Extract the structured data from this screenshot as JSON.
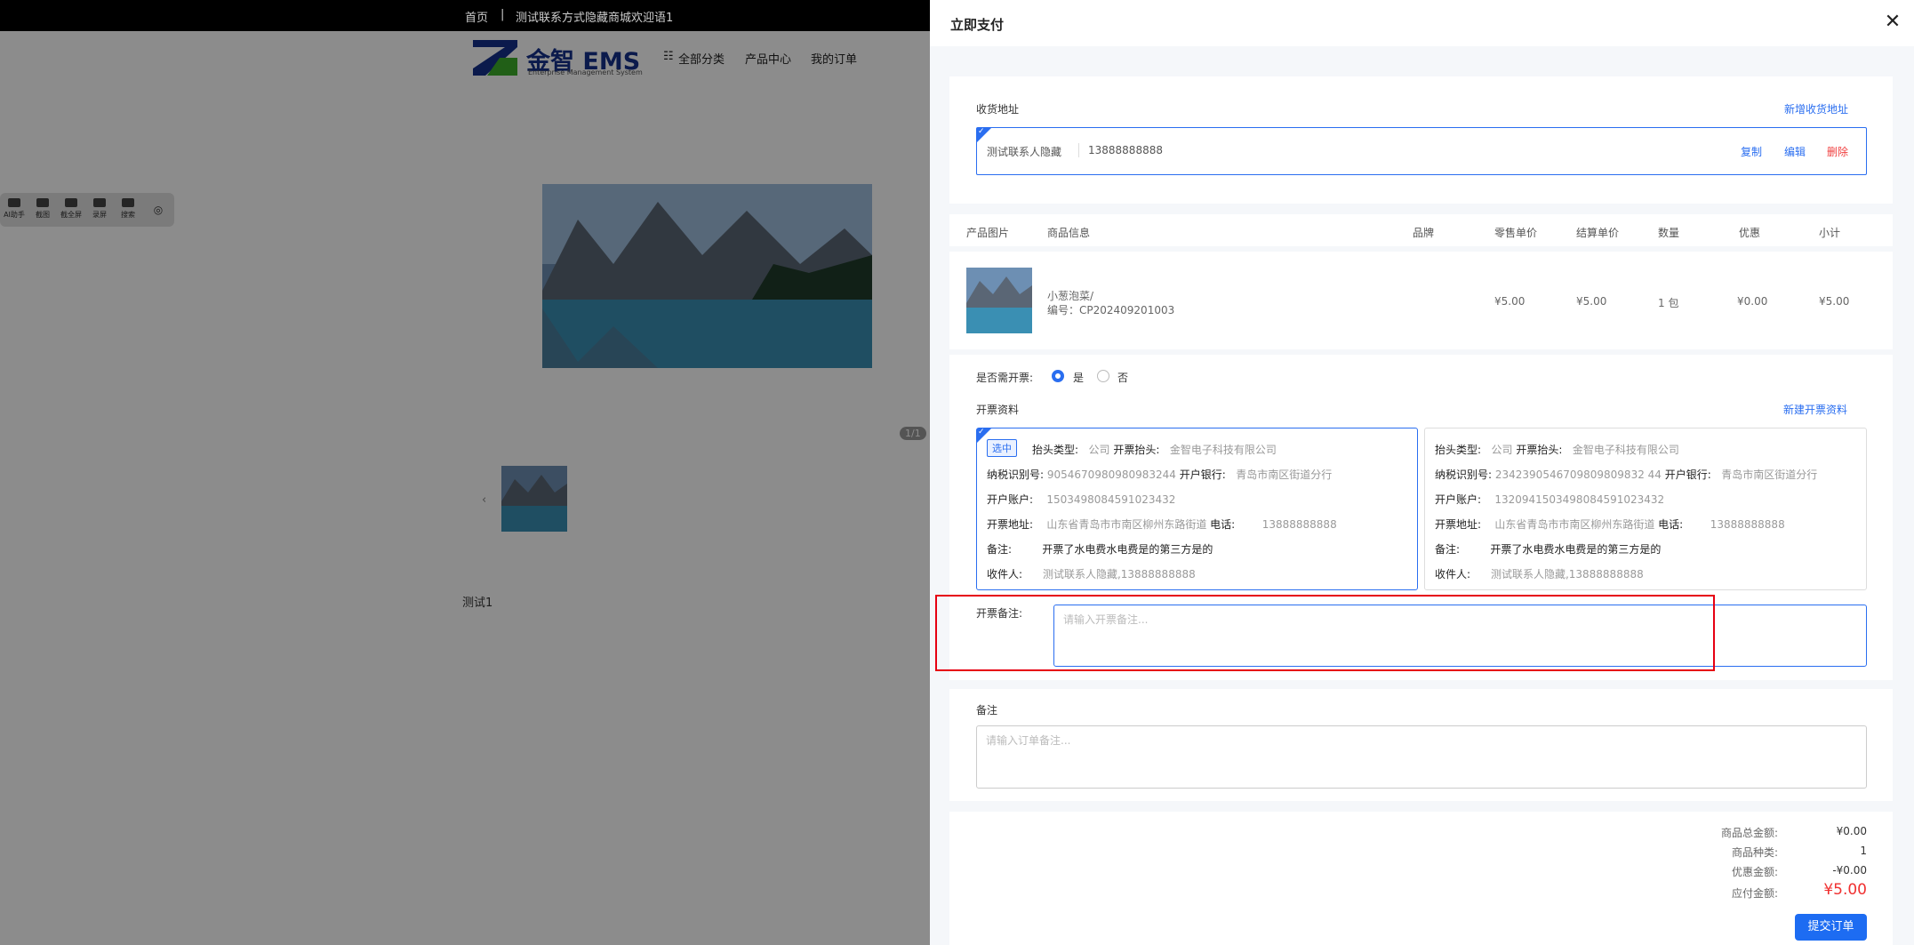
{
  "background": {
    "topbar": {
      "home": "首页",
      "divider": "|",
      "welcome": "测试联系方式隐藏商城欢迎语1"
    },
    "logo": {
      "title": "金智 EMS",
      "subtitle": "Enterprise Management System"
    },
    "nav": {
      "all_categories": "全部分类",
      "products": "产品中心",
      "orders": "我的订单"
    },
    "tools": [
      "AI助手",
      "截图",
      "截全屏",
      "录屏",
      "搜索"
    ],
    "pager": "1/1",
    "section_label": "测试1"
  },
  "panel": {
    "title": "立即支付",
    "address": {
      "label": "收货地址",
      "add_link": "新增收货地址",
      "name": "测试联系人隐藏",
      "phone": "13888888888",
      "copy": "复制",
      "edit": "编辑",
      "delete": "删除"
    },
    "table": {
      "headers": [
        "产品图片",
        "商品信息",
        "品牌",
        "零售单价",
        "结算单价",
        "数量",
        "优惠",
        "小计"
      ],
      "row": {
        "name": "小葱泡菜/",
        "code": "编号：CP202409201003",
        "retail": "¥5.00",
        "settle": "¥5.00",
        "qty": "1 包",
        "discount": "¥0.00",
        "subtotal": "¥5.00"
      }
    },
    "invoice": {
      "need_label": "是否需开票:",
      "yes": "是",
      "no": "否",
      "info_label": "开票资料",
      "new_link": "新建开票资料",
      "selected_tag": "选中",
      "cards": [
        {
          "type_label": "抬头类型:",
          "type": "公司",
          "title_label": "开票抬头:",
          "title": "金智电子科技有限公司",
          "tax_label": "纳税识别号:",
          "tax": "9054670980980983244",
          "bank_label": "开户银行:",
          "bank": "青岛市南区街道分行",
          "account_label": "开户账户:",
          "account": "1503498084591023432",
          "addr_label": "开票地址:",
          "addr": "山东省青岛市市南区柳州东路街道",
          "tel_label": "电话:",
          "tel": "13888888888",
          "remark_label": "备注:",
          "remark": "开票了水电费水电费是的第三方是的",
          "receiver_label": "收件人:",
          "receiver": "测试联系人隐藏,13888888888"
        },
        {
          "type_label": "抬头类型:",
          "type": "公司",
          "title_label": "开票抬头:",
          "title": "金智电子科技有限公司",
          "tax_label": "纳税识别号:",
          "tax": "2342390546709809809832 44",
          "bank_label": "开户银行:",
          "bank": "青岛市南区街道分行",
          "account_label": "开户账户:",
          "account": "1320941503498084591023432",
          "addr_label": "开票地址:",
          "addr": "山东省青岛市市南区柳州东路街道",
          "tel_label": "电话:",
          "tel": "13888888888",
          "remark_label": "备注:",
          "remark": "开票了水电费水电费是的第三方是的",
          "receiver_label": "收件人:",
          "receiver": "测试联系人隐藏,13888888888"
        }
      ],
      "remark_label": "开票备注:",
      "remark_placeholder": "请输入开票备注..."
    },
    "note": {
      "label": "备注",
      "placeholder": "请输入订单备注..."
    },
    "summary": {
      "total_label": "商品总金额:",
      "total": "¥0.00",
      "kinds_label": "商品种类:",
      "kinds": "1",
      "discount_label": "优惠金额:",
      "discount": "-¥0.00",
      "payable_label": "应付金额:",
      "payable": "¥5.00"
    },
    "submit": "提交订单"
  }
}
